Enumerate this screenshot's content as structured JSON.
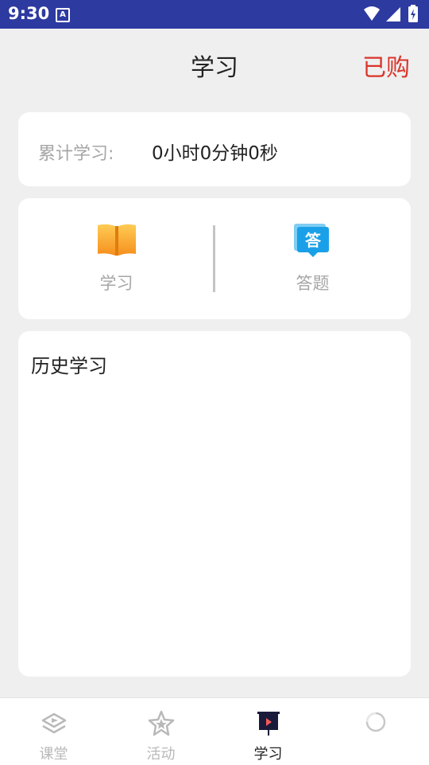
{
  "status_bar": {
    "time": "9:30",
    "notification_letter": "A"
  },
  "header": {
    "title": "学习",
    "purchased_label": "已购"
  },
  "study_time": {
    "label": "累计学习:",
    "value": "0小时0分钟0秒"
  },
  "quick_nav": [
    {
      "label": "学习",
      "icon": "open-book-icon",
      "color": "#f7a12b"
    },
    {
      "label": "答题",
      "icon": "answer-bubble-icon",
      "color": "#1aa0e8",
      "glyph": "答"
    }
  ],
  "history": {
    "heading": "历史学习"
  },
  "bottom_nav": {
    "active": "学习",
    "items": [
      {
        "label": "课堂",
        "icon": "classroom-icon"
      },
      {
        "label": "活动",
        "icon": "star-icon"
      },
      {
        "label": "学习",
        "icon": "presentation-board-icon"
      },
      {
        "label": "",
        "icon": "loading-circle-icon"
      }
    ]
  },
  "colors": {
    "status_bar": "#2d3aa0",
    "accent_red": "#d9342b",
    "page_background": "#efefef",
    "muted_text": "#a6a6a6"
  }
}
